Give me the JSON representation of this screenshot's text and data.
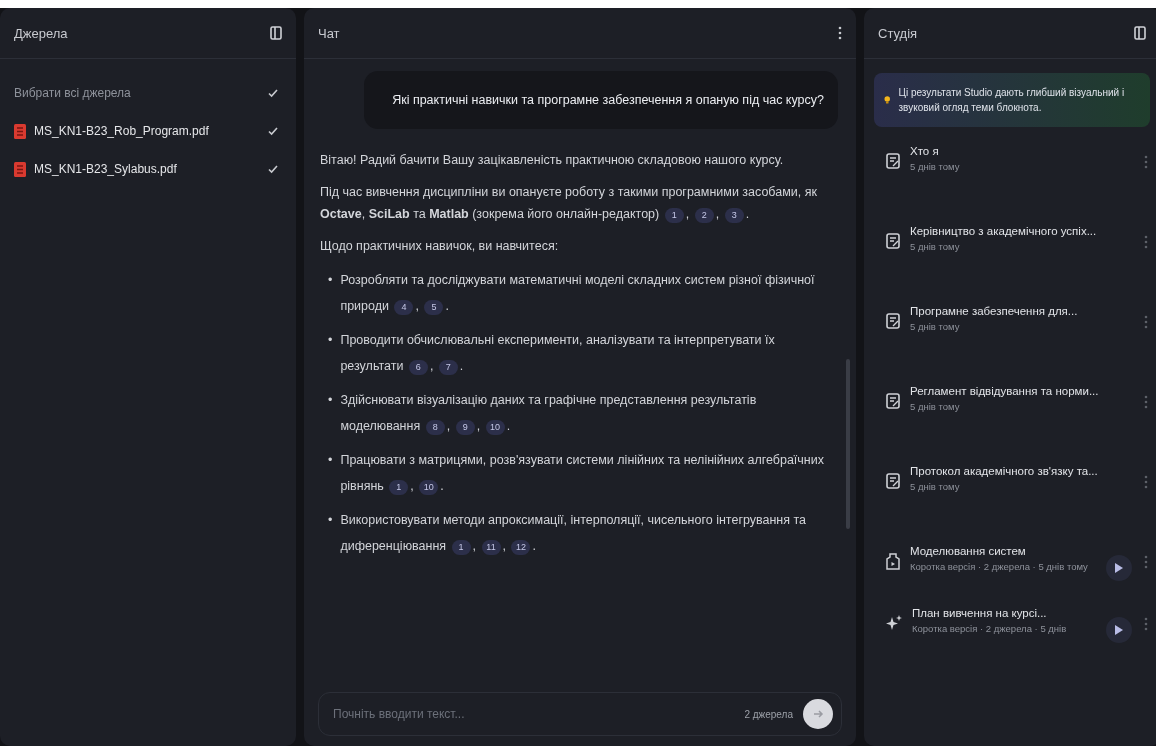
{
  "sources": {
    "title": "Джерела",
    "select_all": {
      "label": "Вибрати всі джерела",
      "checked": true
    },
    "items": [
      {
        "name": "MS_KN1-B23_Rob_Program.pdf",
        "checked": true
      },
      {
        "name": "MS_KN1-B23_Sylabus.pdf",
        "checked": true
      }
    ]
  },
  "chat": {
    "title": "Чат",
    "question": "Які практичні навички та програмне забезпечення я опаную під час курсу?",
    "paragraphs": [
      {
        "text": "Вітаю! Радий бачити Вашу зацікавленість практичною складовою нашого курсу."
      },
      {
        "text": "Під час вивчення дисципліни ви опануєте роботу з такими програмними засобами, як **Octave**, **SciLab** та **Matlab** (зокрема його онлайн-редактор)",
        "citations": [
          {
            "n": "1",
            "after": ","
          },
          {
            "n": "2",
            "after": ","
          },
          {
            "n": "3",
            "after": "."
          }
        ]
      },
      {
        "text": "Щодо практичних навичок, ви навчитеся:"
      }
    ],
    "bullets": [
      {
        "marker": "•",
        "text": "Розробляти та досліджувати математичні моделі складних систем різної фізичної природи",
        "citations": [
          {
            "n": "4",
            "after": ","
          },
          {
            "n": "5",
            "after": "."
          }
        ]
      },
      {
        "marker": "•",
        "text": "Проводити обчислювальні експерименти, аналізувати та інтерпретувати їх результати",
        "citations": [
          {
            "n": "6",
            "after": ","
          },
          {
            "n": "7",
            "after": "."
          }
        ]
      },
      {
        "marker": "•",
        "text": "Здійснювати візуалізацію даних та графічне представлення результатів моделювання",
        "citations": [
          {
            "n": "8",
            "after": ","
          },
          {
            "n": "9",
            "after": ","
          },
          {
            "n": "10",
            "after": "."
          }
        ]
      },
      {
        "marker": "•",
        "text": "Працювати з матрицями, розв'язувати системи лінійних та нелінійних алгебраїчних рівнянь",
        "citations": [
          {
            "n": "1",
            "after": ","
          },
          {
            "n": "10",
            "after": "."
          }
        ]
      },
      {
        "marker": "•",
        "text": "Використовувати методи апроксимації, інтерполяції, чисельного інтегрування та диференціювання",
        "citations": [
          {
            "n": "1",
            "after": ","
          },
          {
            "n": "11",
            "after": ","
          },
          {
            "n": "12",
            "after": "."
          }
        ]
      }
    ],
    "input": {
      "placeholder": "Почніть вводити текст...",
      "source_count": "2 джерела"
    }
  },
  "studio": {
    "title": "Студія",
    "banner": "Ці результати Studio дають глибший візуальний і звуковий огляд теми блокнота.",
    "items": [
      {
        "kind": "note",
        "title": "Хто я",
        "meta": "5 днів тому"
      },
      {
        "kind": "note",
        "title": "Керівництво з академічного успіх...",
        "meta": "5 днів тому"
      },
      {
        "kind": "note",
        "title": "Програмне забезпечення для...",
        "meta": "5 днів тому"
      },
      {
        "kind": "note",
        "title": "Регламент відвідування та норми...",
        "meta": "5 днів тому"
      },
      {
        "kind": "note",
        "title": "Протокол академічного зв'язку та...",
        "meta": "5 днів тому"
      },
      {
        "kind": "audio",
        "title": "Моделювання систем",
        "meta": "Коротка версія · 2 джерела · 5 днів тому"
      },
      {
        "kind": "video",
        "title": "План вивчення на курсі...",
        "meta": "Коротка версія · 2 джерела · 5 днів"
      }
    ]
  }
}
